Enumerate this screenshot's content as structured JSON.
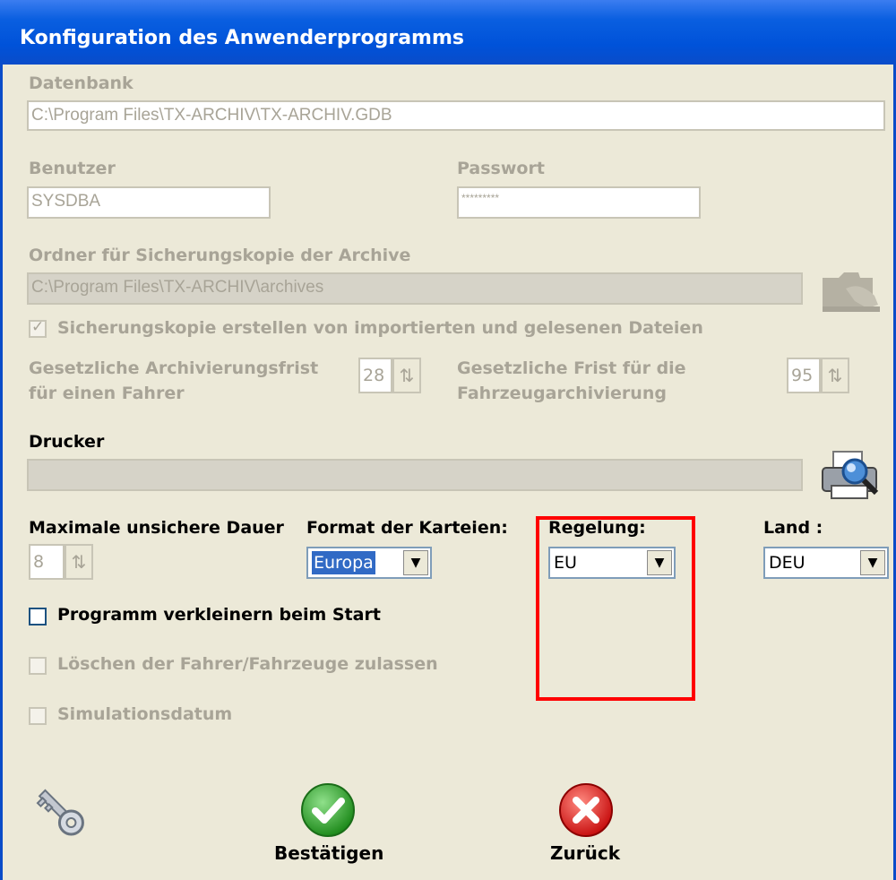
{
  "window": {
    "title": "Konfiguration des Anwenderprogramms"
  },
  "database": {
    "label": "Datenbank",
    "value": "C:\\Program Files\\TX-ARCHIV\\TX-ARCHIV.GDB"
  },
  "user": {
    "label": "Benutzer",
    "value": "SYSDBA"
  },
  "password": {
    "label": "Passwort",
    "value": "*********"
  },
  "backup": {
    "label": "Ordner für Sicherungskopie der Archive",
    "value": "C:\\Program Files\\TX-ARCHIV\\archives",
    "checkbox_label": "Sicherungskopie erstellen von importierten und gelesenen Dateien"
  },
  "retention_driver": {
    "label_line1": "Gesetzliche Archivierungsfrist",
    "label_line2": "für einen Fahrer",
    "value": "28"
  },
  "retention_vehicle": {
    "label_line1": "Gesetzliche Frist für die",
    "label_line2": "Fahrzeugarchivierung",
    "value": "95"
  },
  "printer": {
    "label": "Drucker",
    "value": ""
  },
  "max_unsafe": {
    "label": "Maximale unsichere Dauer",
    "value": "8"
  },
  "card_format": {
    "label": "Format der Karteien:",
    "value": "Europa"
  },
  "regulation": {
    "label": "Regelung:",
    "value": "EU"
  },
  "country": {
    "label": "Land :",
    "value": "DEU"
  },
  "options": {
    "minimize": "Programm verkleinern beim Start",
    "delete_allowed": "Löschen der Fahrer/Fahrzeuge zulassen",
    "simulation_date": "Simulationsdatum"
  },
  "buttons": {
    "confirm": "Bestätigen",
    "back": "Zurück"
  },
  "colors": {
    "highlight_box": "#ff0000",
    "title_bar": "#0052d9"
  }
}
